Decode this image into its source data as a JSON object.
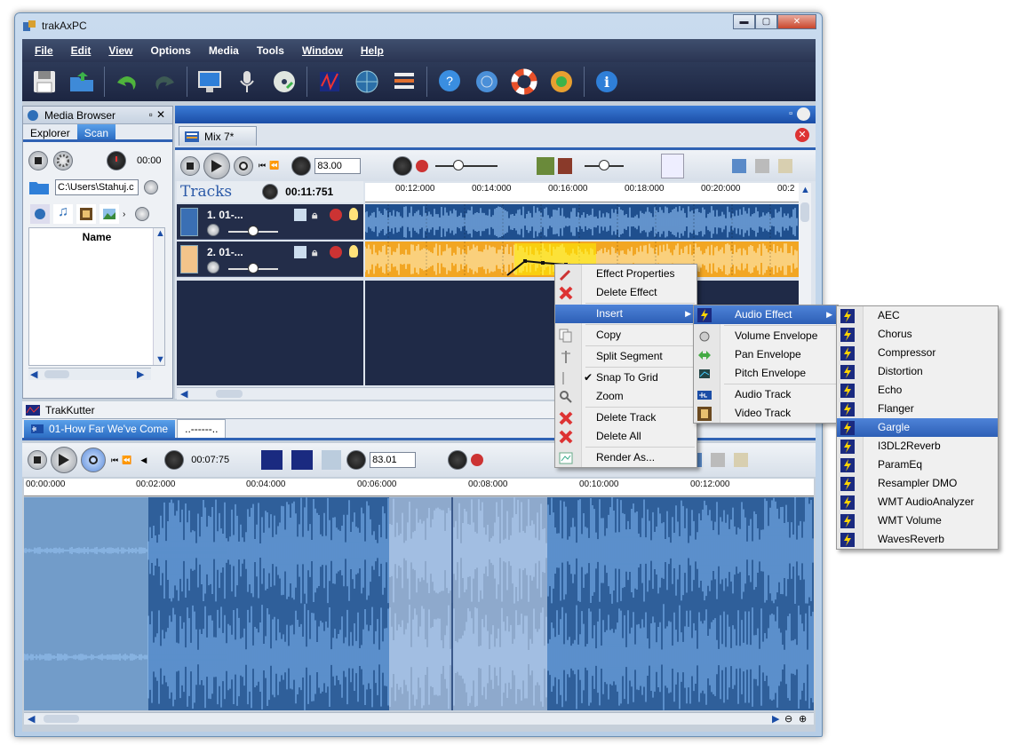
{
  "window": {
    "title": "trakAxPC",
    "minimize": "▬",
    "maximize": "▢",
    "close": "✕"
  },
  "menubar": [
    "File",
    "Edit",
    "View",
    "Options",
    "Media",
    "Tools",
    "Window",
    "Help"
  ],
  "media_browser": {
    "title": "Media Browser",
    "tabs": [
      "Explorer",
      "Scan"
    ],
    "active_tab": "Scan",
    "time": "00:00",
    "path": "C:\\Users\\Stahuj.c",
    "list_header": "Name"
  },
  "mix": {
    "tab_label": "Mix 7*",
    "tempo": "83.00",
    "tracks_label": "Tracks",
    "duration": "00:11:751",
    "ruler": [
      "00:12:000",
      "00:14:000",
      "00:16:000",
      "00:18:000",
      "00:20:000",
      "00:2"
    ],
    "tracks": [
      {
        "name": "1. 01-...",
        "color": "#3a6fb4"
      },
      {
        "name": "2. 01-...",
        "color": "#f2a623"
      }
    ]
  },
  "trakkutter": {
    "title": "TrakKutter",
    "tabs": [
      "01-How Far We've Come",
      "..------.."
    ],
    "time": "00:07:75",
    "tempo": "83.01",
    "ruler": [
      "00:00:000",
      "00:02:000",
      "00:04:000",
      "00:06:000",
      "00:08:000",
      "00:10:000",
      "00:12:000"
    ]
  },
  "context_menu": {
    "items": [
      "Effect Properties",
      "Delete Effect",
      "Insert",
      "Copy",
      "Split Segment",
      "Snap To Grid",
      "Zoom",
      "Delete Track",
      "Delete All",
      "Render As..."
    ],
    "checked": "Snap To Grid",
    "highlighted": "Insert"
  },
  "insert_menu": {
    "items": [
      "Audio Effect",
      "Volume Envelope",
      "Pan Envelope",
      "Pitch Envelope",
      "Audio Track",
      "Video Track"
    ],
    "highlighted": "Audio Effect"
  },
  "effects_menu": {
    "items": [
      "AEC",
      "Chorus",
      "Compressor",
      "Distortion",
      "Echo",
      "Flanger",
      "Gargle",
      "I3DL2Reverb",
      "ParamEq",
      "Resampler DMO",
      "WMT AudioAnalyzer",
      "WMT Volume",
      "WavesReverb"
    ],
    "highlighted": "Gargle"
  },
  "colors": {
    "accent": "#2f62b4",
    "track2": "#f2a623",
    "wave": "#2f5f9a",
    "menu_highlight": "#3a6fc9"
  }
}
